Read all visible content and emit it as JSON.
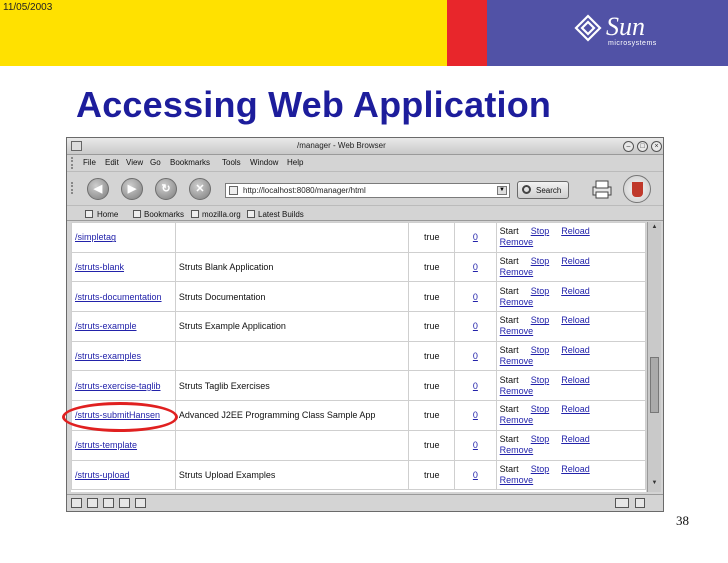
{
  "slide": {
    "date": "11/05/2003",
    "title": "Accessing Web Application",
    "page_number": "38",
    "brand": {
      "name": "Sun",
      "sub": "microsystems"
    },
    "colors": {
      "header_yellow": "#ffe100",
      "header_red": "#e8262b",
      "header_blue": "#5152a6",
      "title": "#1d1d9c",
      "highlight": "#e02020"
    }
  },
  "browser": {
    "window_title": "/manager - Web Browser",
    "menu": [
      "File",
      "Edit",
      "View",
      "Go",
      "Bookmarks",
      "Tools",
      "Window",
      "Help"
    ],
    "url": "http://localhost:8080/manager/html",
    "search_label": "Search",
    "bookmarks": [
      "Home",
      "Bookmarks",
      "mozilla.org",
      "Latest Builds"
    ]
  },
  "apps": {
    "rows": [
      {
        "path": "/simpletag",
        "name": "",
        "running": "true",
        "sessions": "0"
      },
      {
        "path": "/struts-blank",
        "name": "Struts Blank Application",
        "running": "true",
        "sessions": "0"
      },
      {
        "path": "/struts-documentation",
        "name": "Struts Documentation",
        "running": "true",
        "sessions": "0"
      },
      {
        "path": "/struts-example",
        "name": "Struts Example Application",
        "running": "true",
        "sessions": "0"
      },
      {
        "path": "/struts-examples",
        "name": "",
        "running": "true",
        "sessions": "0"
      },
      {
        "path": "/struts-exercise-taglib",
        "name": "Struts Taglib Exercises",
        "running": "true",
        "sessions": "0"
      },
      {
        "path": "/struts-submitHansen",
        "name": "Advanced J2EE Programming Class Sample App",
        "running": "true",
        "sessions": "0"
      },
      {
        "path": "/struts-template",
        "name": "",
        "running": "true",
        "sessions": "0"
      },
      {
        "path": "/struts-upload",
        "name": "Struts Upload Examples",
        "running": "true",
        "sessions": "0"
      }
    ],
    "commands": {
      "start": "Start",
      "stop": "Stop",
      "reload": "Reload",
      "remove": "Remove"
    }
  }
}
